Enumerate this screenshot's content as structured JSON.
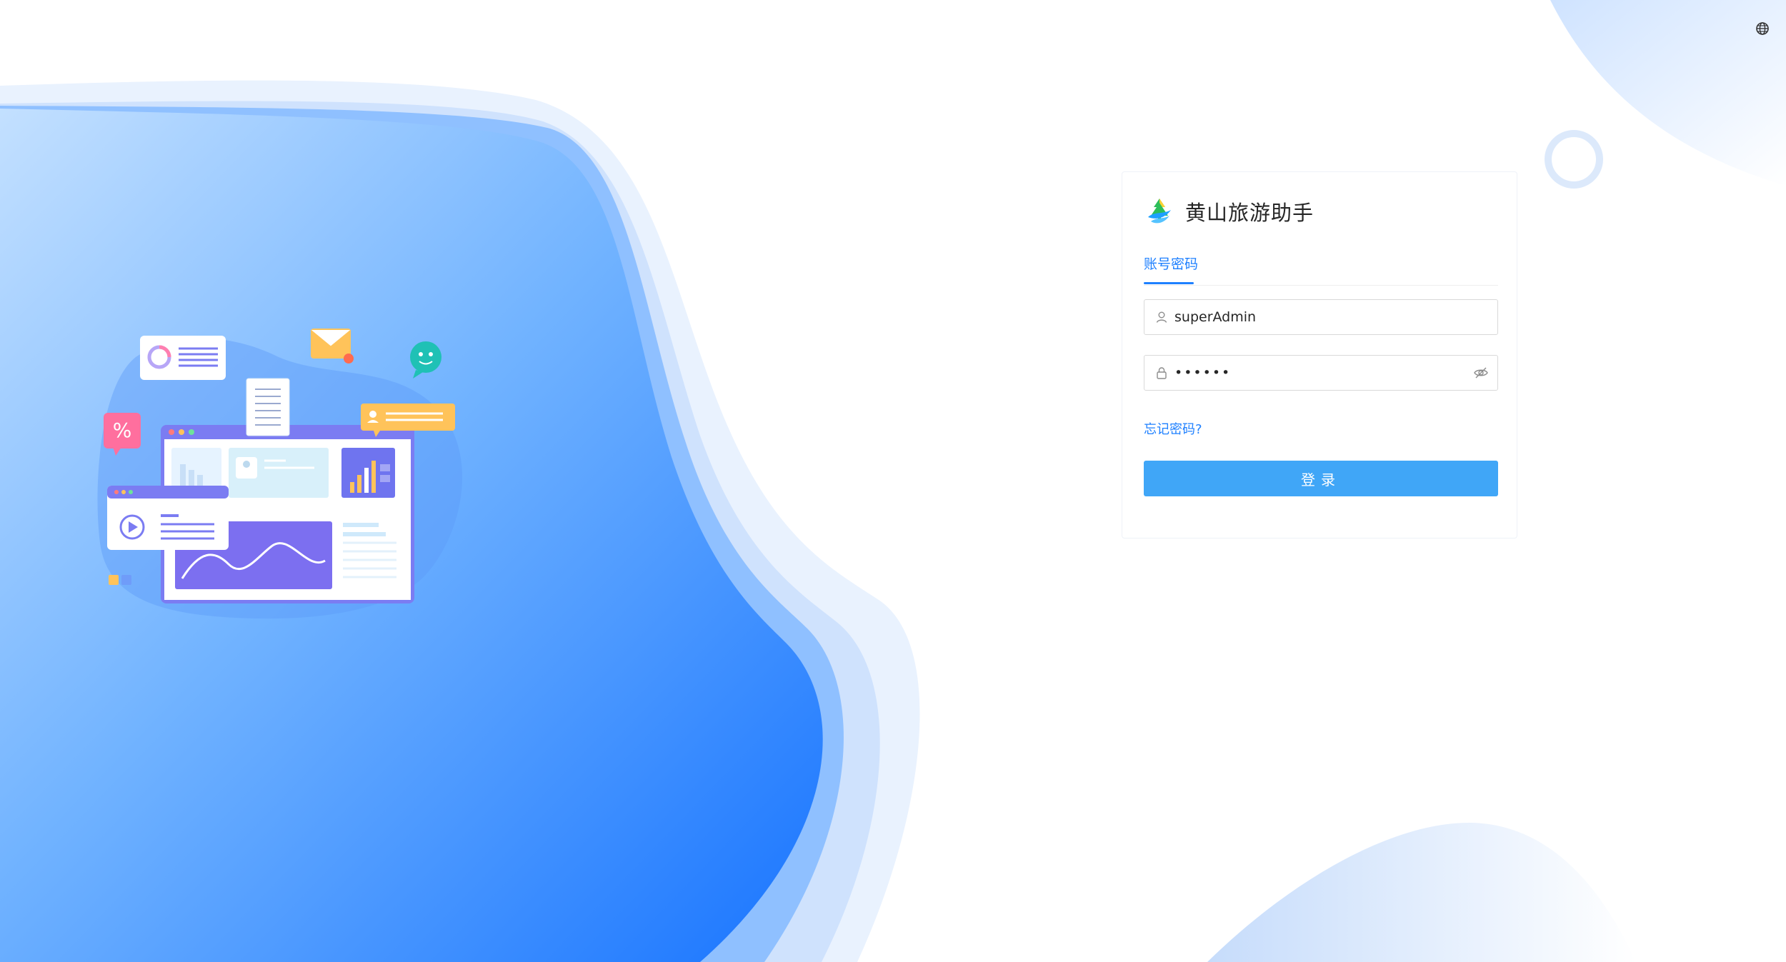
{
  "brand": {
    "title": "黄山旅游助手",
    "logo_icon": "mountain-logo-icon"
  },
  "tabs": [
    {
      "label": "账号密码",
      "active": true
    }
  ],
  "form": {
    "username_value": "superAdmin",
    "username_icon": "user-icon",
    "password_value": "••••••",
    "password_icon": "lock-icon",
    "password_toggle_icon": "eye-slash-icon"
  },
  "links": {
    "forgot_password": "忘记密码?"
  },
  "buttons": {
    "login": "登录"
  },
  "header": {
    "language_icon": "globe-icon"
  },
  "colors": {
    "accent": "#1e80ff",
    "button": "#40a6f7",
    "background_blue": "#1d7cff"
  }
}
